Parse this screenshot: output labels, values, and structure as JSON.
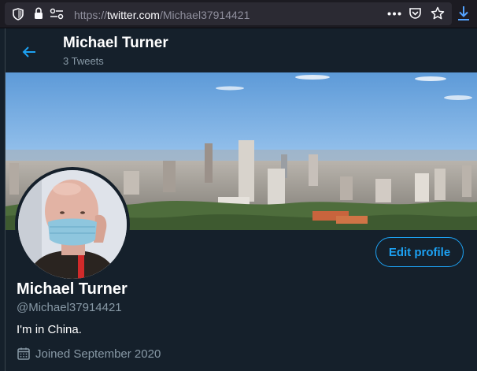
{
  "browser": {
    "url_scheme": "https://",
    "url_domain": "twitter.com",
    "url_path": "/Michael37914421"
  },
  "header": {
    "name": "Michael Turner",
    "tweet_count": "3 Tweets"
  },
  "profile": {
    "name": "Michael Turner",
    "handle": "@Michael37914421",
    "bio": "I'm in China.",
    "joined": "Joined September 2020",
    "edit_label": "Edit profile"
  },
  "colors": {
    "background": "#15202b",
    "accent": "#1da1f2",
    "secondary_text": "#8899a6"
  },
  "icons": {
    "back": "arrow-left-icon",
    "calendar": "calendar-icon",
    "shield": "shield-icon",
    "lock": "lock-icon",
    "permissions": "permissions-icon",
    "more": "more-icon",
    "pocket": "pocket-icon",
    "bookmark": "star-icon",
    "download": "download-icon"
  }
}
